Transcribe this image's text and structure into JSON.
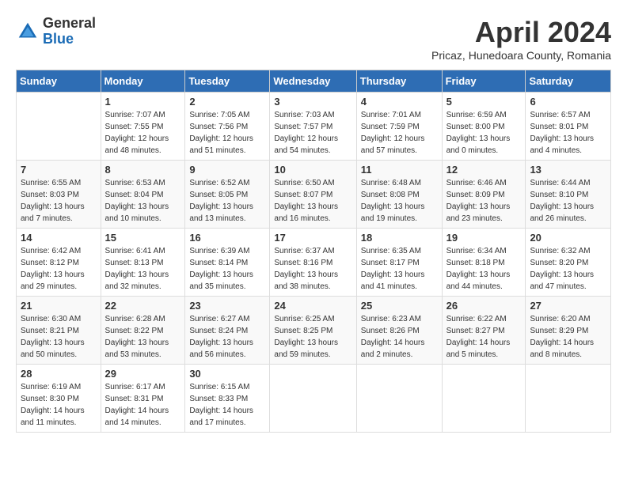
{
  "header": {
    "logo_general": "General",
    "logo_blue": "Blue",
    "month_title": "April 2024",
    "location": "Pricaz, Hunedoara County, Romania"
  },
  "weekdays": [
    "Sunday",
    "Monday",
    "Tuesday",
    "Wednesday",
    "Thursday",
    "Friday",
    "Saturday"
  ],
  "weeks": [
    [
      {
        "day": "",
        "info": ""
      },
      {
        "day": "1",
        "info": "Sunrise: 7:07 AM\nSunset: 7:55 PM\nDaylight: 12 hours\nand 48 minutes."
      },
      {
        "day": "2",
        "info": "Sunrise: 7:05 AM\nSunset: 7:56 PM\nDaylight: 12 hours\nand 51 minutes."
      },
      {
        "day": "3",
        "info": "Sunrise: 7:03 AM\nSunset: 7:57 PM\nDaylight: 12 hours\nand 54 minutes."
      },
      {
        "day": "4",
        "info": "Sunrise: 7:01 AM\nSunset: 7:59 PM\nDaylight: 12 hours\nand 57 minutes."
      },
      {
        "day": "5",
        "info": "Sunrise: 6:59 AM\nSunset: 8:00 PM\nDaylight: 13 hours\nand 0 minutes."
      },
      {
        "day": "6",
        "info": "Sunrise: 6:57 AM\nSunset: 8:01 PM\nDaylight: 13 hours\nand 4 minutes."
      }
    ],
    [
      {
        "day": "7",
        "info": "Sunrise: 6:55 AM\nSunset: 8:03 PM\nDaylight: 13 hours\nand 7 minutes."
      },
      {
        "day": "8",
        "info": "Sunrise: 6:53 AM\nSunset: 8:04 PM\nDaylight: 13 hours\nand 10 minutes."
      },
      {
        "day": "9",
        "info": "Sunrise: 6:52 AM\nSunset: 8:05 PM\nDaylight: 13 hours\nand 13 minutes."
      },
      {
        "day": "10",
        "info": "Sunrise: 6:50 AM\nSunset: 8:07 PM\nDaylight: 13 hours\nand 16 minutes."
      },
      {
        "day": "11",
        "info": "Sunrise: 6:48 AM\nSunset: 8:08 PM\nDaylight: 13 hours\nand 19 minutes."
      },
      {
        "day": "12",
        "info": "Sunrise: 6:46 AM\nSunset: 8:09 PM\nDaylight: 13 hours\nand 23 minutes."
      },
      {
        "day": "13",
        "info": "Sunrise: 6:44 AM\nSunset: 8:10 PM\nDaylight: 13 hours\nand 26 minutes."
      }
    ],
    [
      {
        "day": "14",
        "info": "Sunrise: 6:42 AM\nSunset: 8:12 PM\nDaylight: 13 hours\nand 29 minutes."
      },
      {
        "day": "15",
        "info": "Sunrise: 6:41 AM\nSunset: 8:13 PM\nDaylight: 13 hours\nand 32 minutes."
      },
      {
        "day": "16",
        "info": "Sunrise: 6:39 AM\nSunset: 8:14 PM\nDaylight: 13 hours\nand 35 minutes."
      },
      {
        "day": "17",
        "info": "Sunrise: 6:37 AM\nSunset: 8:16 PM\nDaylight: 13 hours\nand 38 minutes."
      },
      {
        "day": "18",
        "info": "Sunrise: 6:35 AM\nSunset: 8:17 PM\nDaylight: 13 hours\nand 41 minutes."
      },
      {
        "day": "19",
        "info": "Sunrise: 6:34 AM\nSunset: 8:18 PM\nDaylight: 13 hours\nand 44 minutes."
      },
      {
        "day": "20",
        "info": "Sunrise: 6:32 AM\nSunset: 8:20 PM\nDaylight: 13 hours\nand 47 minutes."
      }
    ],
    [
      {
        "day": "21",
        "info": "Sunrise: 6:30 AM\nSunset: 8:21 PM\nDaylight: 13 hours\nand 50 minutes."
      },
      {
        "day": "22",
        "info": "Sunrise: 6:28 AM\nSunset: 8:22 PM\nDaylight: 13 hours\nand 53 minutes."
      },
      {
        "day": "23",
        "info": "Sunrise: 6:27 AM\nSunset: 8:24 PM\nDaylight: 13 hours\nand 56 minutes."
      },
      {
        "day": "24",
        "info": "Sunrise: 6:25 AM\nSunset: 8:25 PM\nDaylight: 13 hours\nand 59 minutes."
      },
      {
        "day": "25",
        "info": "Sunrise: 6:23 AM\nSunset: 8:26 PM\nDaylight: 14 hours\nand 2 minutes."
      },
      {
        "day": "26",
        "info": "Sunrise: 6:22 AM\nSunset: 8:27 PM\nDaylight: 14 hours\nand 5 minutes."
      },
      {
        "day": "27",
        "info": "Sunrise: 6:20 AM\nSunset: 8:29 PM\nDaylight: 14 hours\nand 8 minutes."
      }
    ],
    [
      {
        "day": "28",
        "info": "Sunrise: 6:19 AM\nSunset: 8:30 PM\nDaylight: 14 hours\nand 11 minutes."
      },
      {
        "day": "29",
        "info": "Sunrise: 6:17 AM\nSunset: 8:31 PM\nDaylight: 14 hours\nand 14 minutes."
      },
      {
        "day": "30",
        "info": "Sunrise: 6:15 AM\nSunset: 8:33 PM\nDaylight: 14 hours\nand 17 minutes."
      },
      {
        "day": "",
        "info": ""
      },
      {
        "day": "",
        "info": ""
      },
      {
        "day": "",
        "info": ""
      },
      {
        "day": "",
        "info": ""
      }
    ]
  ]
}
